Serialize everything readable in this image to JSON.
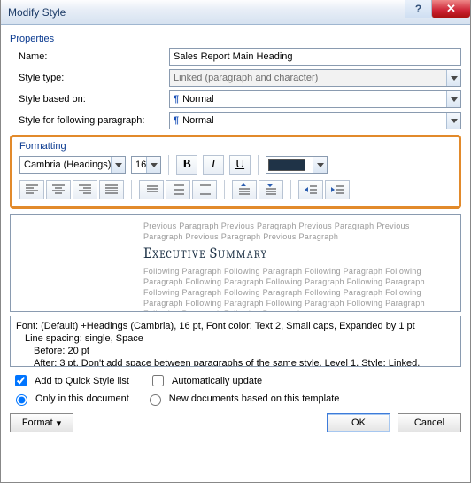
{
  "titlebar": {
    "title": "Modify Style"
  },
  "sections": {
    "properties": "Properties",
    "formatting": "Formatting"
  },
  "props": {
    "name_label": "Name:",
    "name_value": "Sales Report Main Heading",
    "type_label": "Style type:",
    "type_value": "Linked (paragraph and character)",
    "based_label": "Style based on:",
    "based_value": "Normal",
    "following_label": "Style for following paragraph:",
    "following_value": "Normal"
  },
  "formatting": {
    "font": "Cambria (Headings)",
    "size": "16",
    "bold": "B",
    "italic": "I",
    "underline": "U",
    "color": "#1f3347"
  },
  "preview": {
    "prev_para": "Previous Paragraph Previous Paragraph Previous Paragraph Previous Paragraph Previous Paragraph Previous Paragraph",
    "sample": "Executive Summary",
    "next_para": "Following Paragraph Following Paragraph Following Paragraph Following Paragraph Following Paragraph Following Paragraph Following Paragraph Following Paragraph Following Paragraph Following Paragraph Following Paragraph Following Paragraph Following Paragraph Following Paragraph Following Paragraph Following Paragraph"
  },
  "description": {
    "line1": "Font: (Default) +Headings (Cambria), 16 pt, Font color: Text 2, Small caps, Expanded by  1 pt",
    "line2": "Line spacing:  single, Space",
    "line3": "Before:  20 pt",
    "line4": "After:  3 pt, Don't add space between paragraphs of the same style, Level 1, Style: Linked,"
  },
  "options": {
    "add_quick": "Add to Quick Style list",
    "auto_update": "Automatically update",
    "only_doc": "Only in this document",
    "new_template": "New documents based on this template"
  },
  "buttons": {
    "format": "Format",
    "ok": "OK",
    "cancel": "Cancel"
  }
}
